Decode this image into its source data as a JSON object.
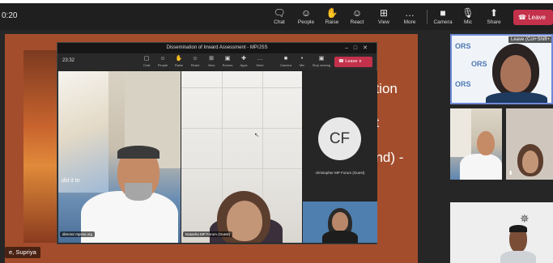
{
  "toolbar": {
    "timer": "0:20",
    "buttons": [
      {
        "label": "Chat",
        "icon": "chat-icon"
      },
      {
        "label": "People",
        "icon": "people-icon"
      },
      {
        "label": "Raise",
        "icon": "raise-hand-icon"
      },
      {
        "label": "React",
        "icon": "react-icon"
      },
      {
        "label": "View",
        "icon": "view-icon"
      },
      {
        "label": "More",
        "icon": "more-icon"
      },
      {
        "label": "Camera",
        "icon": "camera-icon"
      },
      {
        "label": "Mic",
        "icon": "mic-icon"
      },
      {
        "label": "Share",
        "icon": "share-icon"
      }
    ],
    "leave_label": "Leave"
  },
  "slide": {
    "line1": "ation",
    "line2": "nt",
    "line3": "and)  -",
    "presenter": "e, Supriya"
  },
  "inner_window": {
    "title": "Dissemination of Inward Assessment - MP/JSS",
    "timer": "23:32",
    "buttons": [
      {
        "label": "Chat",
        "icon": "chat-icon"
      },
      {
        "label": "People",
        "icon": "people-icon"
      },
      {
        "label": "Raise",
        "icon": "raise-hand-icon"
      },
      {
        "label": "React",
        "icon": "react-icon"
      },
      {
        "label": "View",
        "icon": "view-icon"
      },
      {
        "label": "Rooms",
        "icon": "rooms-icon"
      },
      {
        "label": "Apps",
        "icon": "apps-icon"
      },
      {
        "label": "More",
        "icon": "more-icon"
      },
      {
        "label": "Camera",
        "icon": "camera-icon"
      },
      {
        "label": "Mic",
        "icon": "mic-icon"
      },
      {
        "label": "Stop sharing",
        "icon": "stop-sharing-icon"
      }
    ],
    "leave_label": "Leave",
    "tiles": {
      "director_name": "director mpsss.org",
      "natasha_name": "Natasha MP Forum (Guest)",
      "cf_initials": "CF",
      "cf_name": "christopher MP Forum (Guest)",
      "poster_text": "did it to"
    }
  },
  "right_tiles": {
    "speaker_name": "Leave (Col+Shift+...",
    "logo_text": "ORS"
  }
}
